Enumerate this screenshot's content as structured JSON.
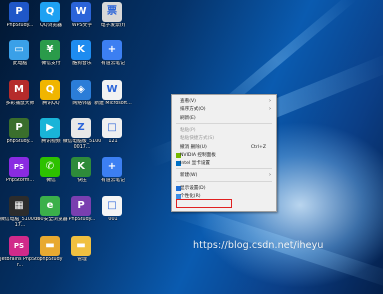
{
  "desktop": {
    "icons": [
      {
        "label": "PhpStudy...",
        "icon": "phpstudy-icon",
        "color": "#1f57c8"
      },
      {
        "label": "QQ浏览器",
        "icon": "qq-browser-icon",
        "color": "#1ea1f2"
      },
      {
        "label": "WPS文字",
        "icon": "wps-writer-icon",
        "color": "#2b64d9"
      },
      {
        "label": "电子发票(f)",
        "icon": "einvoice-icon",
        "color": "#d8d8d8"
      },
      {
        "label": "此电脑",
        "icon": "this-pc-icon",
        "color": "#3aa0e8"
      },
      {
        "label": "微信支付",
        "icon": "wechat-pay-icon",
        "color": "#2a9b4a"
      },
      {
        "label": "酷狗音乐",
        "icon": "kugou-music-icon",
        "color": "#1e8cf0"
      },
      {
        "label": "有道云笔记",
        "icon": "youdao-note-icon",
        "color": "#3c7ff2"
      },
      {
        "label": "多彩捕鼠大师",
        "icon": "mouse-master-icon",
        "color": "#b52b2b"
      },
      {
        "label": "腾讯QQ",
        "icon": "tencent-qq-icon",
        "color": "#f0b500"
      },
      {
        "label": "网络邻居",
        "icon": "network-icon",
        "color": "#2b7dd8"
      },
      {
        "label": "新建 Microsoft...",
        "icon": "word-doc-icon",
        "color": "#f2f2f2"
      },
      {
        "label": "phpStudy...",
        "icon": "phpstudy-icon-2",
        "color": "#3a6e2c"
      },
      {
        "label": "腾讯视频",
        "icon": "tencent-video-icon",
        "color": "#19b4d8"
      },
      {
        "label": "微信电脑版_51000017...",
        "icon": "wechat-file-icon",
        "color": "#e8e8e8"
      },
      {
        "label": "121",
        "icon": "file-121-icon",
        "color": "#f0f0f0"
      },
      {
        "label": "PhpStorm...",
        "icon": "phpstorm-icon",
        "color": "#8a2be2"
      },
      {
        "label": "微信",
        "icon": "wechat-icon",
        "color": "#2dc100"
      },
      {
        "label": "快压",
        "icon": "kuaiya-icon",
        "color": "#2e8b3a"
      },
      {
        "label": "有道云笔记",
        "icon": "youdao-note-icon-2",
        "color": "#3c7ff2"
      },
      {
        "label": "微信电脑_51000017...",
        "icon": "wechat-file-icon-2",
        "color": "#2c2c2c"
      },
      {
        "label": "360安全浏览器",
        "icon": "browser-360-icon",
        "color": "#3bb04a"
      },
      {
        "label": "PhpStudy...",
        "icon": "phpstudy-icon-3",
        "color": "#7a3fb0"
      },
      {
        "label": "001",
        "icon": "file-001-icon",
        "color": "#f5f5f5"
      },
      {
        "label": "JetBrains PhpStor...",
        "icon": "jetbrains-icon",
        "color": "#d12a8a"
      },
      {
        "label": "phpStudy",
        "icon": "phpstudy-folder-icon",
        "color": "#e8a930"
      },
      {
        "label": "管理",
        "icon": "manage-folder-icon",
        "color": "#f0c040"
      }
    ]
  },
  "context_menu": {
    "items": [
      {
        "label": "查看(V)",
        "arrow": "›"
      },
      {
        "label": "排序方式(O)",
        "arrow": "›"
      },
      {
        "label": "刷新(E)"
      },
      {
        "sep": true
      },
      {
        "label": "粘贴(P)",
        "disabled": true
      },
      {
        "label": "粘贴快捷方式(S)",
        "disabled": true
      },
      {
        "label": "撤消 删除(U)",
        "shortcut": "Ctrl+Z"
      },
      {
        "label": "NVIDIA 控制面板",
        "icon": "nvidia-icon",
        "icon_color": "#76b900"
      },
      {
        "label": "Intel 显卡设置",
        "icon": "intel-icon",
        "icon_color": "#0071c5"
      },
      {
        "sep": true
      },
      {
        "label": "新建(W)",
        "arrow": "›"
      },
      {
        "sep": true
      },
      {
        "label": "显示设置(D)",
        "icon": "display-icon",
        "icon_color": "#1e6fd8"
      },
      {
        "label": "个性化(R)",
        "icon": "personalize-icon",
        "icon_color": "#3b8fe6"
      }
    ]
  },
  "watermark": "https://blog.csdn.net/iheyu"
}
